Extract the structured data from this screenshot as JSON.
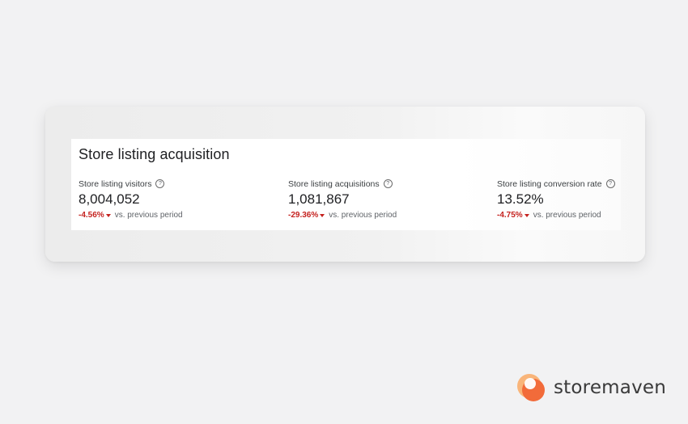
{
  "widget": {
    "title": "Store listing acquisition",
    "metrics": [
      {
        "label": "Store listing visitors",
        "help_icon": "help-circle-icon",
        "value": "8,004,052",
        "change": "-4.56%",
        "direction_icon": "down-arrow-icon",
        "comparison": "vs. previous period"
      },
      {
        "label": "Store listing acquisitions",
        "help_icon": "help-circle-icon",
        "value": "1,081,867",
        "change": "-29.36%",
        "direction_icon": "down-arrow-icon",
        "comparison": "vs. previous period"
      },
      {
        "label": "Store listing conversion rate",
        "help_icon": "help-circle-icon",
        "value": "13.52%",
        "change": "-4.75%",
        "direction_icon": "down-arrow-icon",
        "comparison": "vs. previous period"
      }
    ]
  },
  "brand": {
    "name": "storemaven",
    "logo_icon": "storemaven-logo-icon"
  },
  "colors": {
    "negative": "#c5221f",
    "brand_orange": "#f26b3a",
    "brand_light": "#f9b57a",
    "background": "#f2f2f3"
  }
}
